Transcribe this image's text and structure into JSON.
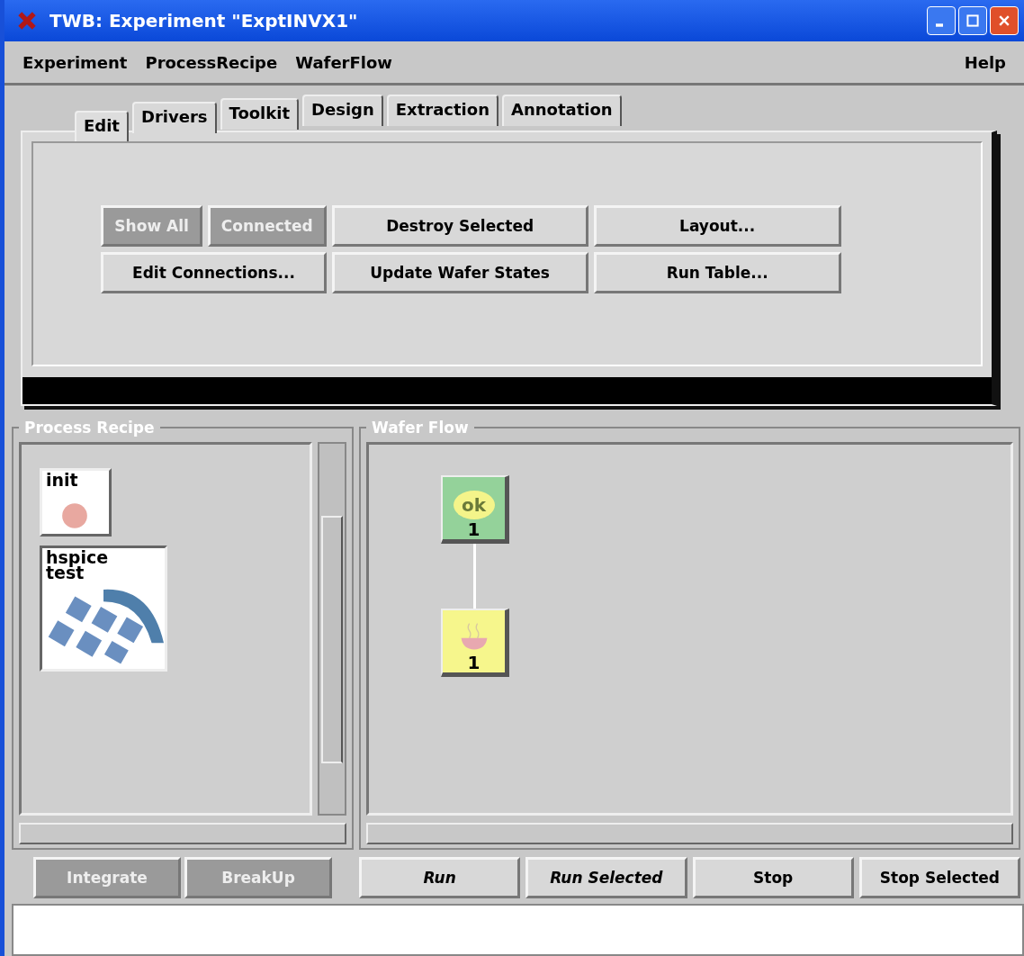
{
  "window": {
    "title": "TWB: Experiment \"ExptINVX1\""
  },
  "menu": {
    "left": [
      "Experiment",
      "ProcessRecipe",
      "WaferFlow"
    ],
    "right": "Help"
  },
  "tabs": [
    {
      "label": "Edit",
      "selected": true
    },
    {
      "label": "Drivers",
      "selected": false
    },
    {
      "label": "Toolkit",
      "selected": false
    },
    {
      "label": "Design",
      "selected": false
    },
    {
      "label": "Extraction",
      "selected": false
    },
    {
      "label": "Annotation",
      "selected": false
    }
  ],
  "edit_buttons": [
    {
      "label": "Show All",
      "disabled": true,
      "kind": "half"
    },
    {
      "label": "Connected",
      "disabled": true,
      "kind": "half"
    },
    {
      "label": "Destroy Selected",
      "disabled": false,
      "kind": "full"
    },
    {
      "label": "Layout...",
      "disabled": false,
      "kind": "full"
    },
    {
      "label": "Edit Connections...",
      "disabled": false,
      "kind": "wide"
    },
    {
      "label": "Update Wafer States",
      "disabled": false,
      "kind": "full"
    },
    {
      "label": "Run Table...",
      "disabled": false,
      "kind": "full"
    }
  ],
  "process_recipe": {
    "title": "Process Recipe",
    "nodes": [
      {
        "label": "init",
        "kind": "dot"
      },
      {
        "label": "hspice test",
        "kind": "globe"
      }
    ],
    "buttons": [
      {
        "label": "Integrate",
        "disabled": true
      },
      {
        "label": "BreakUp",
        "disabled": true
      }
    ]
  },
  "wafer_flow": {
    "title": "Wafer Flow",
    "nodes": [
      {
        "kind": "ok",
        "badge": "ok",
        "count": "1",
        "color": "#94d29a"
      },
      {
        "kind": "cup",
        "count": "1",
        "color": "#f6f68c"
      }
    ],
    "buttons": [
      {
        "label": "Run",
        "italic": true
      },
      {
        "label": "Run Selected",
        "italic": true
      },
      {
        "label": "Stop",
        "italic": false
      },
      {
        "label": "Stop Selected",
        "italic": false
      }
    ]
  }
}
